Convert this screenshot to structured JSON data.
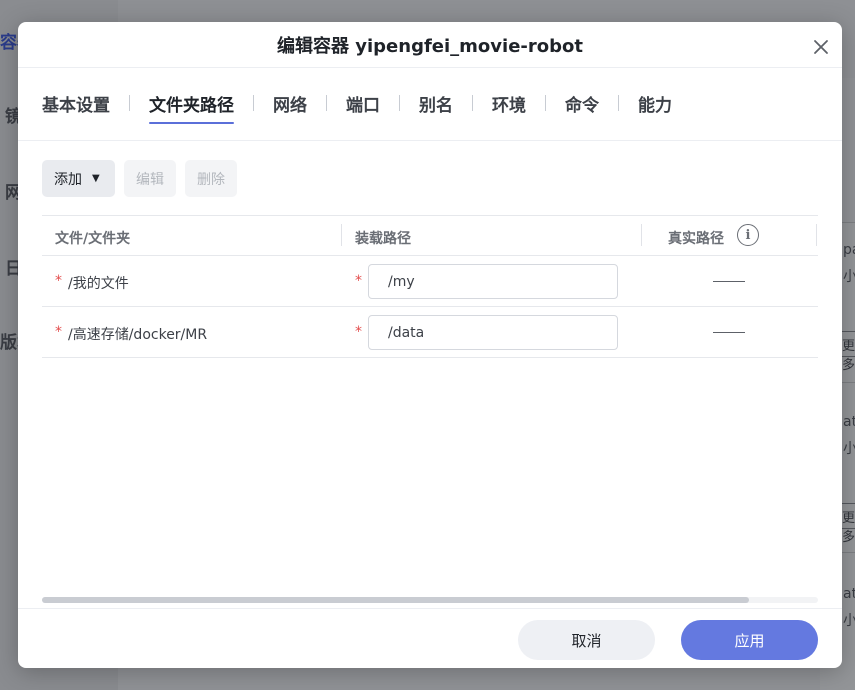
{
  "background": {
    "sidebar_items": [
      "容器",
      "镜",
      "网",
      "日",
      "版本"
    ],
    "card_texts": [
      "pa",
      "小",
      "更多",
      "at",
      "小",
      "更多",
      "at",
      "小"
    ]
  },
  "modal": {
    "title": "编辑容器 yipengfei_movie-robot",
    "close_icon": "close-icon"
  },
  "tabs": [
    {
      "label": "基本设置",
      "active": false
    },
    {
      "label": "文件夹路径",
      "active": true
    },
    {
      "label": "网络",
      "active": false
    },
    {
      "label": "端口",
      "active": false
    },
    {
      "label": "别名",
      "active": false
    },
    {
      "label": "环境",
      "active": false
    },
    {
      "label": "命令",
      "active": false
    },
    {
      "label": "能力",
      "active": false
    }
  ],
  "toolbar": {
    "add_label": "添加",
    "edit_label": "编辑",
    "delete_label": "删除"
  },
  "table": {
    "headers": {
      "file": "文件/文件夹",
      "mount": "装载路径",
      "real": "真实路径"
    },
    "required_mark": "*",
    "rows": [
      {
        "file": "/我的文件",
        "mount": "/my",
        "real": "——"
      },
      {
        "file": "/高速存储/docker/MR",
        "mount": "/data",
        "real": "——"
      }
    ]
  },
  "footer": {
    "cancel_label": "取消",
    "apply_label": "应用"
  },
  "colors": {
    "accent": "#6479e0",
    "required": "#e34d4d"
  }
}
